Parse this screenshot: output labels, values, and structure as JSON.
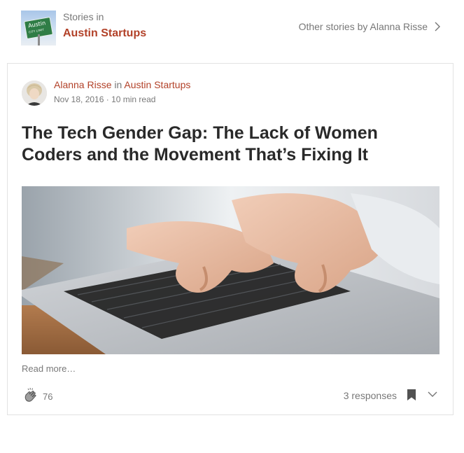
{
  "header": {
    "stories_in_label": "Stories in",
    "publication_name": "Austin Startups",
    "logo_sign_line1": "Austin",
    "logo_sign_line2": "CITY LIMIT",
    "other_stories_label": "Other stories by Alanna Risse"
  },
  "story": {
    "author": "Alanna Risse",
    "in_word": "in",
    "publication": "Austin Startups",
    "date": "Nov 18, 2016",
    "separator": "·",
    "read_time": "10 min read",
    "title": "The Tech Gender Gap: The Lack of Women Coders and the Movement That’s Fixing It",
    "read_more": "Read more…",
    "clap_count": "76",
    "responses": "3 responses"
  },
  "icons": {
    "other_stories": "chevron-right-icon",
    "clap": "clap-icon",
    "bookmark": "bookmark-icon",
    "more": "chevron-down-icon"
  },
  "colors": {
    "accent": "#b24128",
    "muted_text": "rgba(0,0,0,0.54)",
    "border": "#e2e2e2"
  }
}
